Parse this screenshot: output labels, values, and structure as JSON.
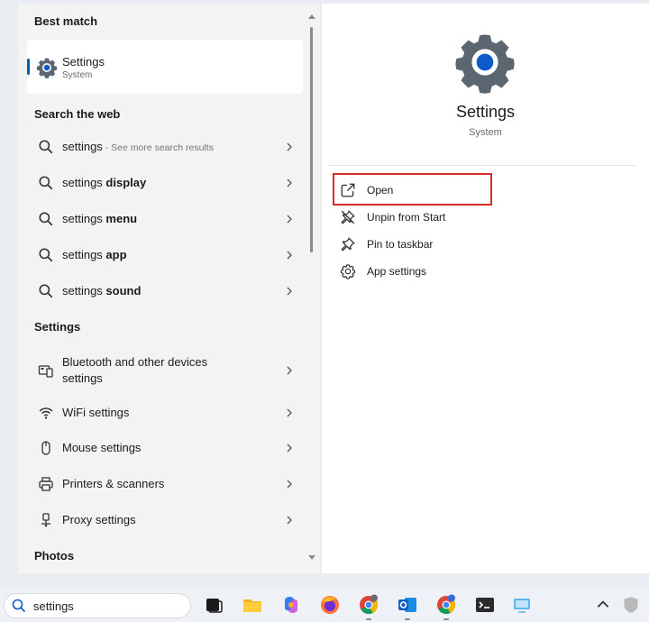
{
  "left": {
    "best_match_title": "Best match",
    "best_match": {
      "name": "Settings",
      "type": "System",
      "icon": "gear-icon"
    },
    "web_title": "Search the web",
    "web_results": [
      {
        "prefix": "settings",
        "bold": "",
        "suffix": " - See more search results"
      },
      {
        "prefix": "settings ",
        "bold": "display",
        "suffix": ""
      },
      {
        "prefix": "settings ",
        "bold": "menu",
        "suffix": ""
      },
      {
        "prefix": "settings ",
        "bold": "app",
        "suffix": ""
      },
      {
        "prefix": "settings ",
        "bold": "sound",
        "suffix": ""
      }
    ],
    "settings_title": "Settings",
    "settings_results": [
      {
        "label_line1": "Bluetooth and other devices",
        "label_line2": "settings",
        "icon": "devices-icon"
      },
      {
        "label_line1": "WiFi settings",
        "icon": "wifi-icon"
      },
      {
        "label_line1": "Mouse settings",
        "icon": "mouse-icon"
      },
      {
        "label_line1": "Printers & scanners",
        "icon": "printer-icon"
      },
      {
        "label_line1": "Proxy settings",
        "icon": "proxy-icon"
      }
    ],
    "photos_title": "Photos"
  },
  "right": {
    "app_name": "Settings",
    "app_type": "System",
    "actions": [
      {
        "label": "Open",
        "icon": "open-external-icon"
      },
      {
        "label": "Unpin from Start",
        "icon": "unpin-icon"
      },
      {
        "label": "Pin to taskbar",
        "icon": "pin-icon"
      },
      {
        "label": "App settings",
        "icon": "gear-icon"
      }
    ],
    "highlight_color": "#d62e2e"
  },
  "taskbar": {
    "search_value": "settings",
    "apps": [
      "task-view",
      "file-explorer",
      "copilot",
      "firefox",
      "chrome",
      "outlook",
      "chrome-profile",
      "terminal",
      "remote-desktop"
    ],
    "tray": [
      "chevron-up",
      "security"
    ]
  },
  "colors": {
    "accent": "#005fb8",
    "gear_blue": "#0b5cc9",
    "gear_gray": "#5b6670"
  }
}
